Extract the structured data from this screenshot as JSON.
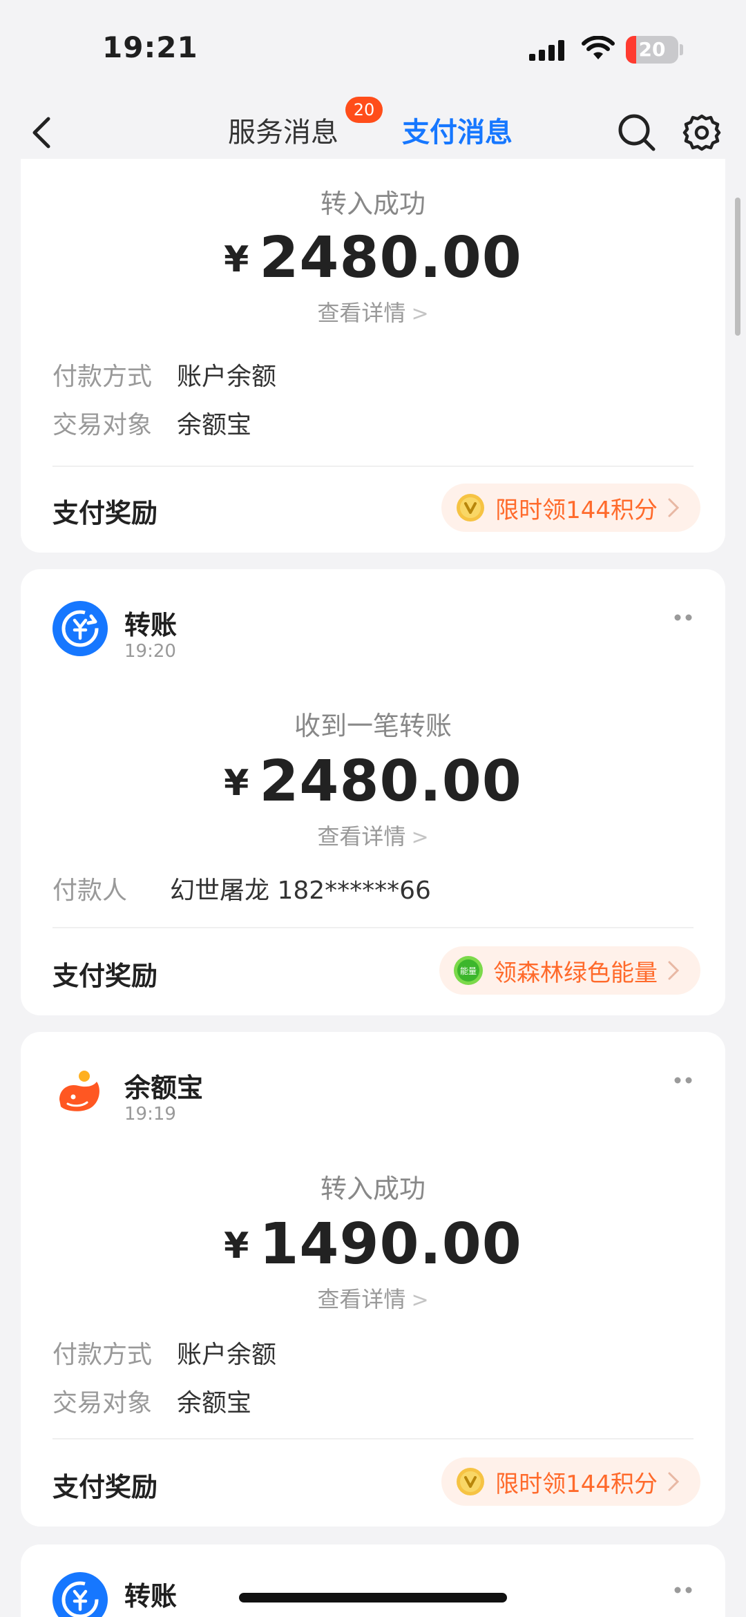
{
  "status_bar": {
    "time": "19:21",
    "battery": "20",
    "battery_level": 0.2
  },
  "nav": {
    "tabs": [
      {
        "label": "服务消息",
        "badge": "20",
        "active": false
      },
      {
        "label": "支付消息",
        "active": true
      }
    ]
  },
  "cards": [
    {
      "title": "转入成功",
      "currency": "¥",
      "amount": "2480.00",
      "detail": "查看详情",
      "rows": [
        {
          "key": "付款方式",
          "value": "账户余额"
        },
        {
          "key": "交易对象",
          "value": "余额宝"
        }
      ],
      "reward_label": "支付奖励",
      "reward_text": "限时领144积分",
      "reward_icon": "points-coin-icon"
    },
    {
      "app_name": "转账",
      "app_icon": "transfer-icon",
      "time": "19:20",
      "title": "收到一笔转账",
      "currency": "¥",
      "amount": "2480.00",
      "detail": "查看详情",
      "rows": [
        {
          "key": "付款人",
          "value": "幻世屠龙 182******66"
        }
      ],
      "reward_label": "支付奖励",
      "reward_text": "领森林绿色能量",
      "reward_icon": "green-energy-icon",
      "reward_icon_text": "能量"
    },
    {
      "app_name": "余额宝",
      "app_icon": "yuebao-icon",
      "time": "19:19",
      "title": "转入成功",
      "currency": "¥",
      "amount": "1490.00",
      "detail": "查看详情",
      "rows": [
        {
          "key": "付款方式",
          "value": "账户余额"
        },
        {
          "key": "交易对象",
          "value": "余额宝"
        }
      ],
      "reward_label": "支付奖励",
      "reward_text": "限时领144积分",
      "reward_icon": "points-coin-icon"
    },
    {
      "app_name": "转账",
      "app_icon": "transfer-icon"
    }
  ],
  "colors": {
    "accent": "#1677ff",
    "badge": "#ff4d1a",
    "reward_text": "#ff6a2b",
    "reward_bg": "#fff1ea"
  }
}
